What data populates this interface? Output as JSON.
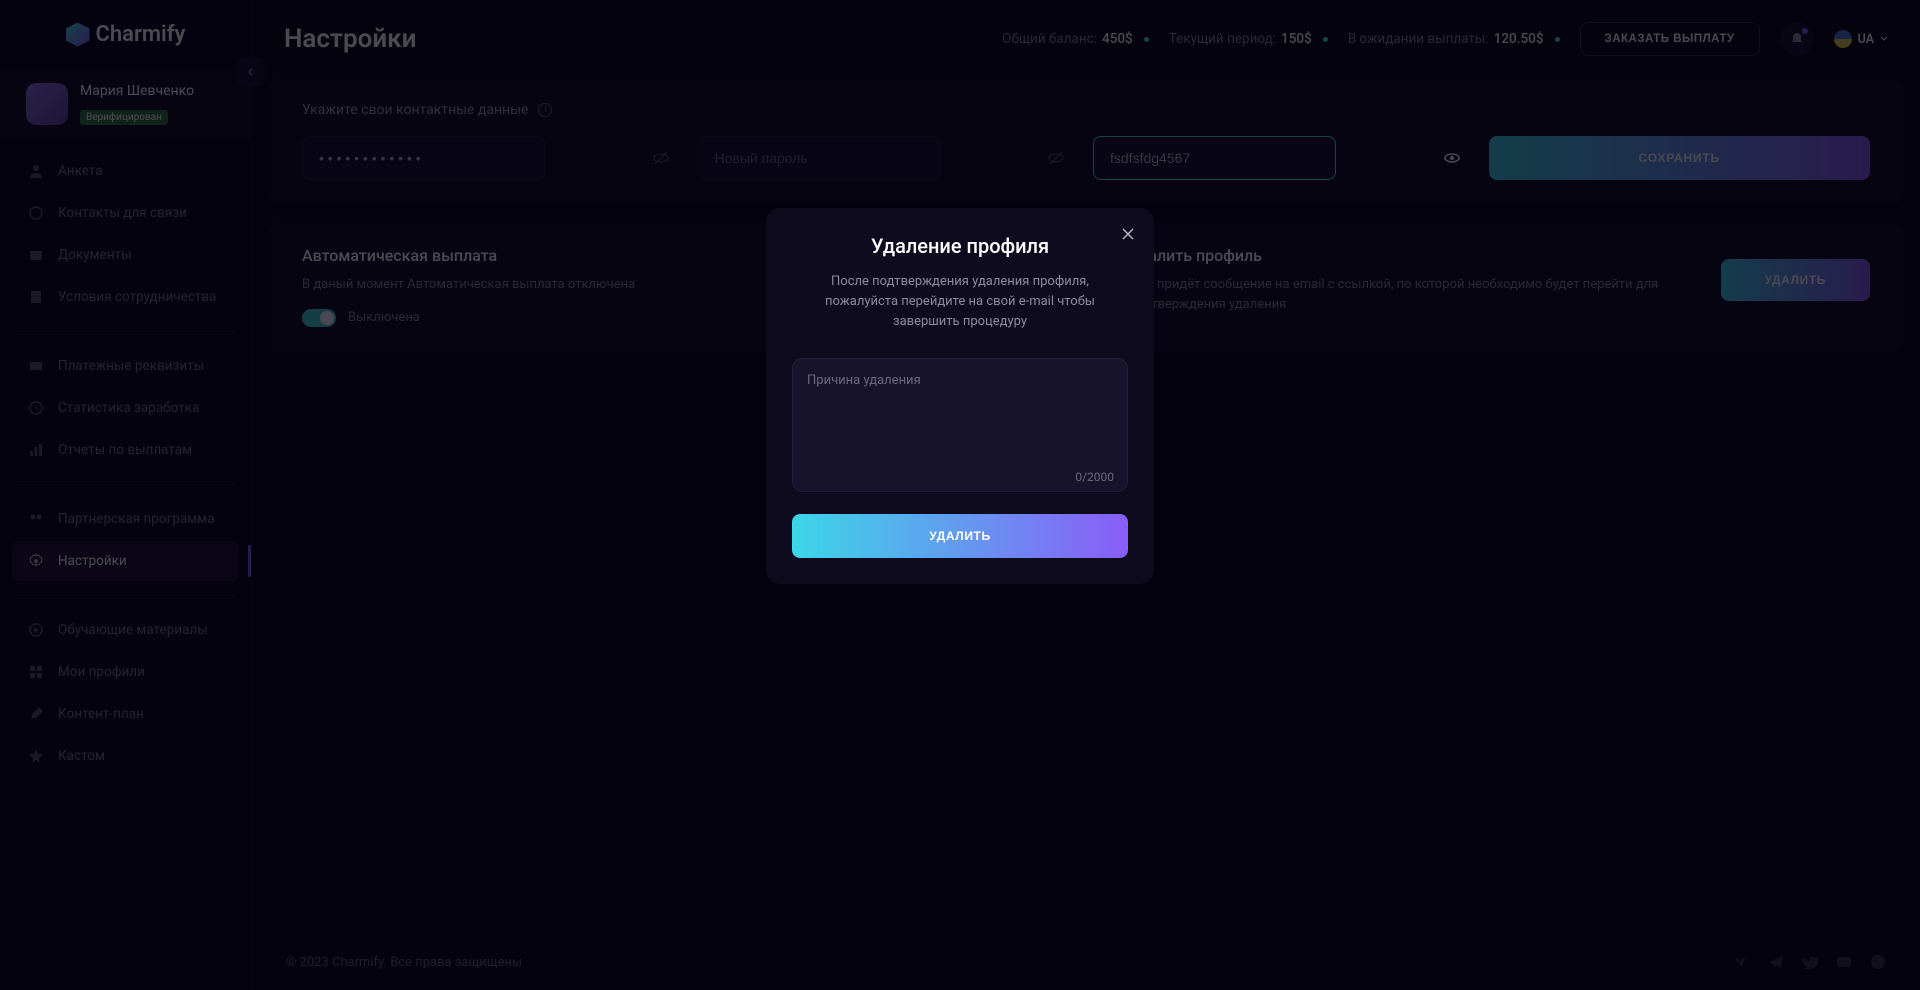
{
  "brand": "Charmify",
  "user": {
    "name": "Мария Шевченко",
    "badge": "Верифицирован"
  },
  "nav": {
    "g1": [
      {
        "label": "Анкета"
      },
      {
        "label": "Контакты для связи"
      },
      {
        "label": "Документы"
      },
      {
        "label": "Условия сотрудничества"
      }
    ],
    "g2": [
      {
        "label": "Платежные реквизиты"
      },
      {
        "label": "Статистика заработка"
      },
      {
        "label": "Отчеты по выплатам"
      }
    ],
    "g3": [
      {
        "label": "Партнерская программа"
      },
      {
        "label": "Настройки"
      }
    ],
    "g4": [
      {
        "label": "Обучающие материалы"
      },
      {
        "label": "Мои профили"
      },
      {
        "label": "Контент-план"
      },
      {
        "label": "Кастом"
      }
    ]
  },
  "header": {
    "title": "Настройки",
    "balance_label": "Общий баланс:",
    "balance_value": "450$",
    "period_label": "Текущий период:",
    "period_value": "150$",
    "pending_label": "В ожидании выплаты:",
    "pending_value": "120.50$",
    "payout_btn": "ЗАКАЗАТЬ ВЫПЛАТУ",
    "lang": "UA"
  },
  "contact": {
    "label": "Укажите свои контактные данные",
    "old_pass_mask": "• • • • • • • • • • • •",
    "new_pass_placeholder": "Новый пароль",
    "repeat_value": "fsdfsfdg4567",
    "save": "СОХРАНИТЬ"
  },
  "auto": {
    "title": "Автоматическая выплата",
    "desc": "В даный момент Автоматическая выплата отключена",
    "toggle_label": "Выключена"
  },
  "delete": {
    "title": "Удалить профиль",
    "desc": "Вам придёт сообщение на email с ссылкой, по которой необходимо будет перейти для подтверждения удаления",
    "btn": "УДАЛИТЬ"
  },
  "footer": {
    "copy": "© 2023 Charmify. Все права защищены"
  },
  "modal": {
    "title": "Удаление профиля",
    "text": "После подтверждения удаления профиля, пожалуйста перейдите на свой e-mail чтобы завершить процедуру",
    "placeholder": "Причина удаления",
    "counter": "0/2000",
    "btn": "УДАЛИТЬ"
  }
}
